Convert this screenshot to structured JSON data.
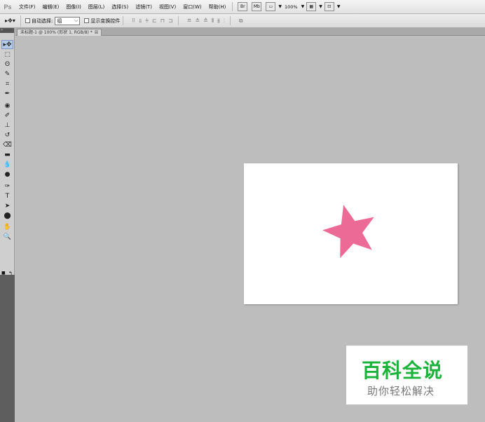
{
  "app": {
    "logo": "Ps"
  },
  "menubar": {
    "items": [
      "文件(F)",
      "编辑(E)",
      "图像(I)",
      "图层(L)",
      "选择(S)",
      "滤镜(T)",
      "视图(V)",
      "窗口(W)",
      "帮助(H)"
    ],
    "buttons": [
      "Br",
      "Mb"
    ],
    "zoom": "100%"
  },
  "options": {
    "auto_select_label": "自动选择:",
    "auto_select_value": "组",
    "show_transform_label": "显示变换控件"
  },
  "document": {
    "tab_title": "未标题-1 @ 100% (形状 1, RGB/8) *",
    "close_glyph": "☒"
  },
  "colors": {
    "foreground": "#ec6a96",
    "background": "#ffffff",
    "star": "#ec6a96",
    "watermark_title": "#1cb33a"
  },
  "tools": [
    "move-tool",
    "marquee-tool",
    "lasso-tool",
    "quick-select-tool",
    "crop-tool",
    "eyedropper-tool",
    "healing-brush-tool",
    "brush-tool",
    "clone-stamp-tool",
    "history-brush-tool",
    "eraser-tool",
    "gradient-tool",
    "blur-tool",
    "dodge-tool",
    "pen-tool",
    "type-tool",
    "path-select-tool",
    "shape-tool",
    "hand-tool",
    "zoom-tool"
  ],
  "watermark": {
    "title": "百科全说",
    "subtitle": "助你轻松解决"
  }
}
